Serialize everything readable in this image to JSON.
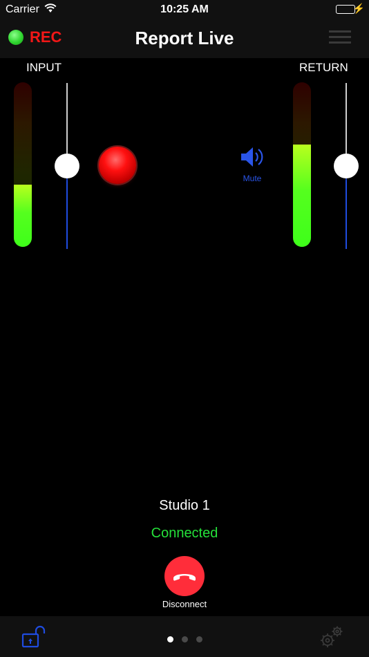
{
  "status_bar": {
    "carrier": "Carrier",
    "time": "10:25 AM",
    "battery_level": 1.0,
    "icons": [
      "wifi-icon",
      "battery-icon",
      "charging-bolt-icon"
    ]
  },
  "header": {
    "rec_label": "REC",
    "rec_indicator_color": "#2fd52f",
    "rec_label_color": "#f21717",
    "title": "Report Live",
    "menu_icon": "hamburger-menu-icon"
  },
  "input": {
    "label": "INPUT",
    "meter_level": 0.38,
    "fader_level": 0.5
  },
  "record_button": {
    "icon": "record-icon",
    "color": "#ff1010"
  },
  "mute": {
    "label": "Mute",
    "icon": "speaker-icon",
    "color": "#2a55e8"
  },
  "return": {
    "label": "RETURN",
    "meter_level": 0.62,
    "fader_level": 0.5
  },
  "connection": {
    "studio_name": "Studio 1",
    "status": "Connected",
    "status_color": "#25e03a",
    "disconnect_label": "Disconnect",
    "disconnect_color": "#ff2d3a"
  },
  "footer": {
    "lock_icon": "unlocked-padlock-icon",
    "settings_icon": "gears-icon",
    "page_count": 3,
    "current_page": 1
  }
}
